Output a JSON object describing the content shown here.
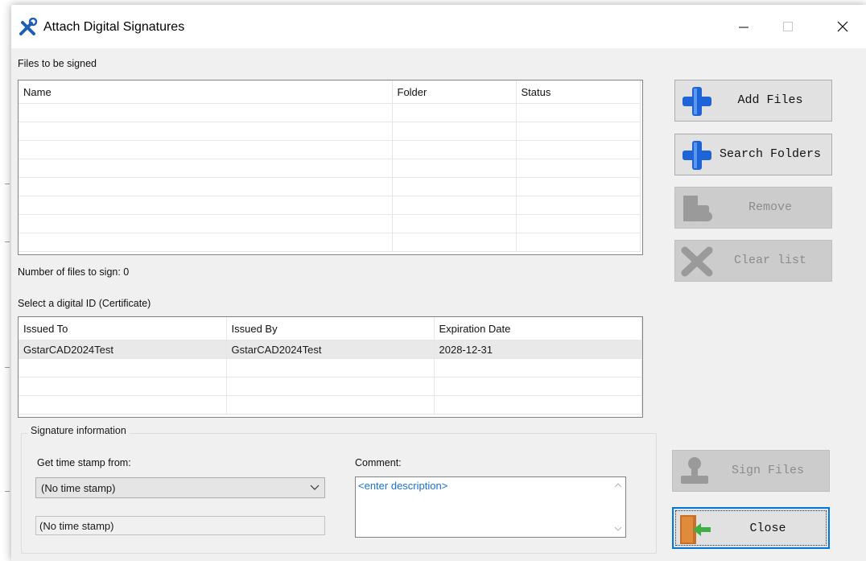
{
  "window": {
    "title": "Attach Digital Signatures",
    "controls": {
      "minimize": "minimize",
      "maximize": "maximize",
      "close": "close"
    }
  },
  "files_section": {
    "label": "Files to be signed",
    "columns": [
      "Name",
      "Folder",
      "Status"
    ],
    "rows": [],
    "count_text": "Number of files to sign: 0"
  },
  "certificate_section": {
    "label": "Select a digital ID (Certificate)",
    "columns": [
      "Issued To",
      "Issued By",
      "Expiration Date"
    ],
    "rows": [
      {
        "issued_to": "GstarCAD2024Test",
        "issued_by": "GstarCAD2024Test",
        "expiration": "2028-12-31"
      }
    ]
  },
  "buttons": {
    "add_files": "Add Files",
    "search_folders": "Search Folders",
    "remove": "Remove",
    "clear_list": "Clear list",
    "sign_files": "Sign Files",
    "close": "Close"
  },
  "signature_info": {
    "title": "Signature information",
    "timestamp_label": "Get time stamp from:",
    "timestamp_selected": "(No time stamp)",
    "timestamp_display": "(No time stamp)",
    "comment_label": "Comment:",
    "comment_placeholder": "<enter description>"
  },
  "colors": {
    "accent": "#0078d7",
    "plus_icon": "#1e64d6",
    "disabled_icon": "#9a9a9a",
    "door_icon": "#c8702a",
    "arrow_icon": "#3cb043"
  }
}
